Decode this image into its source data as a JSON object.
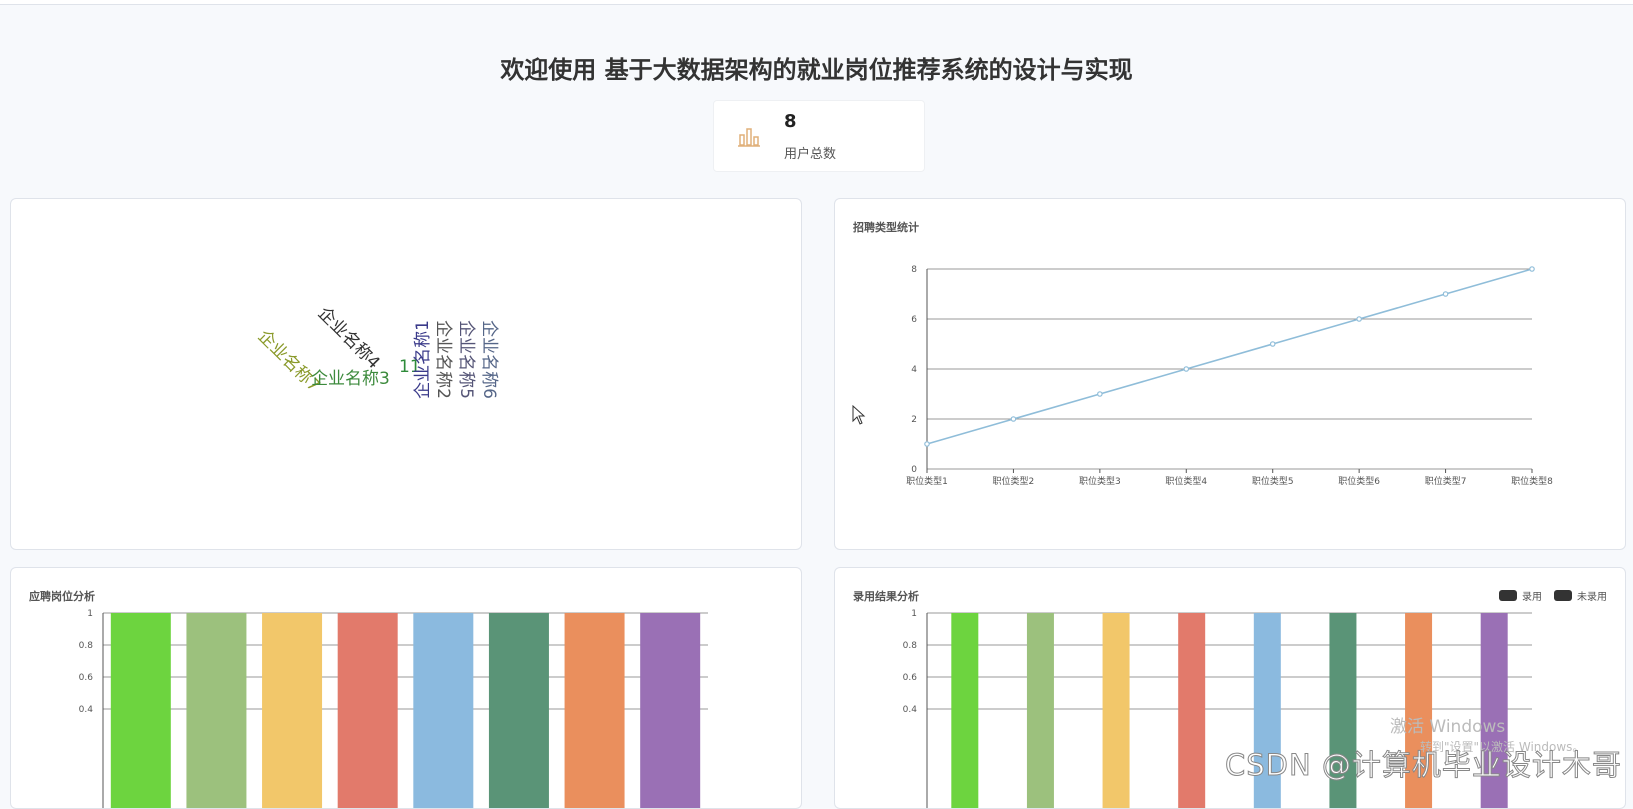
{
  "header": {
    "title": "欢迎使用 基于大数据架构的就业岗位推荐系统的设计与实现"
  },
  "stat": {
    "value": "8",
    "label": "用户总数",
    "icon": "bar-chart-icon",
    "icon_color": "#e0b07a"
  },
  "wordcloud": {
    "words": [
      {
        "text": "企业名称7",
        "color": "#8a9a2a"
      },
      {
        "text": "企业名称4",
        "color": "#333333"
      },
      {
        "text": "企业名称3",
        "color": "#3c8a3c"
      },
      {
        "text": "11",
        "color": "#2e8b3a"
      },
      {
        "text": "企业名称1",
        "color": "#3a3a8a"
      },
      {
        "text": "企业名称2",
        "color": "#555555"
      },
      {
        "text": "企业名称5",
        "color": "#555577"
      },
      {
        "text": "企业名称6",
        "color": "#556688"
      }
    ]
  },
  "chart_data": [
    {
      "type": "line",
      "title": "招聘类型统计",
      "categories": [
        "职位类型1",
        "职位类型2",
        "职位类型3",
        "职位类型4",
        "职位类型5",
        "职位类型6",
        "职位类型7",
        "职位类型8"
      ],
      "values": [
        1,
        2,
        3,
        4,
        5,
        6,
        7,
        8
      ],
      "ylim": [
        0,
        8
      ],
      "yticks": [
        "0",
        "2",
        "4",
        "6",
        "8"
      ],
      "grid": true,
      "color": "#8fbdd9"
    },
    {
      "type": "bar",
      "title": "应聘岗位分析",
      "values": [
        1,
        1,
        1,
        1,
        1,
        1,
        1,
        1
      ],
      "ylim": [
        0,
        1
      ],
      "yticks_visible": [
        "1",
        "0.8",
        "0.6",
        "0.4"
      ],
      "colors": [
        "#6dd43f",
        "#9cc17d",
        "#f2c76a",
        "#e27a6b",
        "#8bbadf",
        "#5a9477",
        "#ea8f5d",
        "#9a70b5"
      ]
    },
    {
      "type": "bar",
      "title": "录用结果分析",
      "values": [
        1,
        1,
        1,
        1,
        1,
        1,
        1,
        1
      ],
      "ylim": [
        0,
        1
      ],
      "yticks_visible": [
        "1",
        "0.8",
        "0.6",
        "0.4"
      ],
      "legend": [
        "录用",
        "未录用"
      ],
      "legend_placement": "top-right",
      "colors": [
        "#6dd43f",
        "#9cc17d",
        "#f2c76a",
        "#e27a6b",
        "#8bbadf",
        "#5a9477",
        "#ea8f5d",
        "#9a70b5"
      ]
    }
  ],
  "watermarks": {
    "activate_line1": "激活 Windows",
    "activate_line2": "转到\"设置\"以激活 Windows。",
    "csdn": "CSDN @计算机毕业设计木哥"
  }
}
